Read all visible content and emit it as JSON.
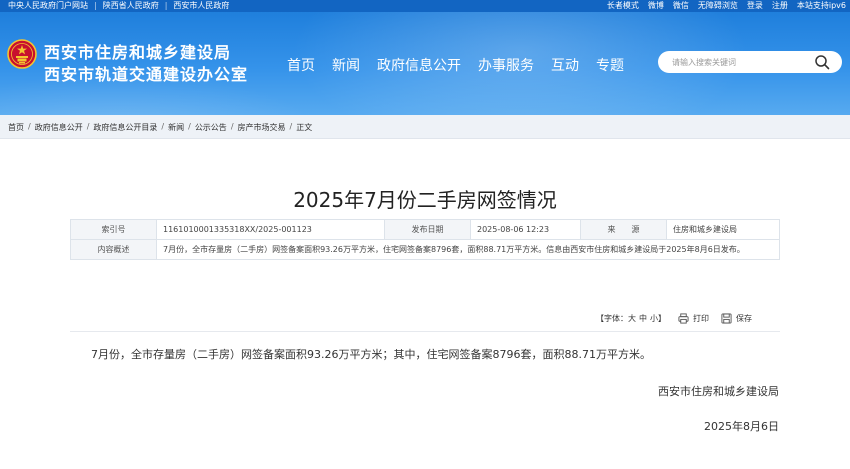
{
  "topbar": {
    "left_links": [
      "中央人民政府门户网站",
      "陕西省人民政府",
      "西安市人民政府"
    ],
    "right_links": [
      "长者模式",
      "微博",
      "微信",
      "无障碍浏览",
      "登录",
      "注册",
      "本站支持ipv6"
    ]
  },
  "header": {
    "org_line1": "西安市住房和城乡建设局",
    "org_line2": "西安市轨道交通建设办公室",
    "nav": [
      "首页",
      "新闻",
      "政府信息公开",
      "办事服务",
      "互动",
      "专题"
    ],
    "search_placeholder": "请输入搜索关键词",
    "colors": {
      "primary": "#1f7fdc",
      "topbar": "#1265c2"
    }
  },
  "breadcrumb": [
    "首页",
    "政府信息公开",
    "政府信息公开目录",
    "新闻",
    "公示公告",
    "房产市场交易",
    "正文"
  ],
  "article": {
    "title": "2025年7月份二手房网签情况",
    "meta": {
      "index_label": "索引号",
      "index_value": "1161010001335318XX/2025-001123",
      "date_label": "发布日期",
      "date_value": "2025-08-06 12:23",
      "source_label": "来　　源",
      "source_value": "住房和城乡建设局",
      "summary_label": "内容概述",
      "summary_value": "7月份，全市存量房（二手房）网签备案面积93.26万平方米，住宅网签备案8796套，面积88.71万平方米。信息由西安市住房和城乡建设局于2025年8月6日发布。"
    },
    "tools": {
      "font_label": "【字体：",
      "font_big": "大",
      "font_mid": "中",
      "font_small": "小】",
      "print": "打印",
      "save": "保存"
    },
    "body": "7月份，全市存量房（二手房）网签备案面积93.26万平方米；其中，住宅网签备案8796套，面积88.71万平方米。",
    "signature": "西安市住房和城乡建设局",
    "sign_date": "2025年8月6日"
  }
}
